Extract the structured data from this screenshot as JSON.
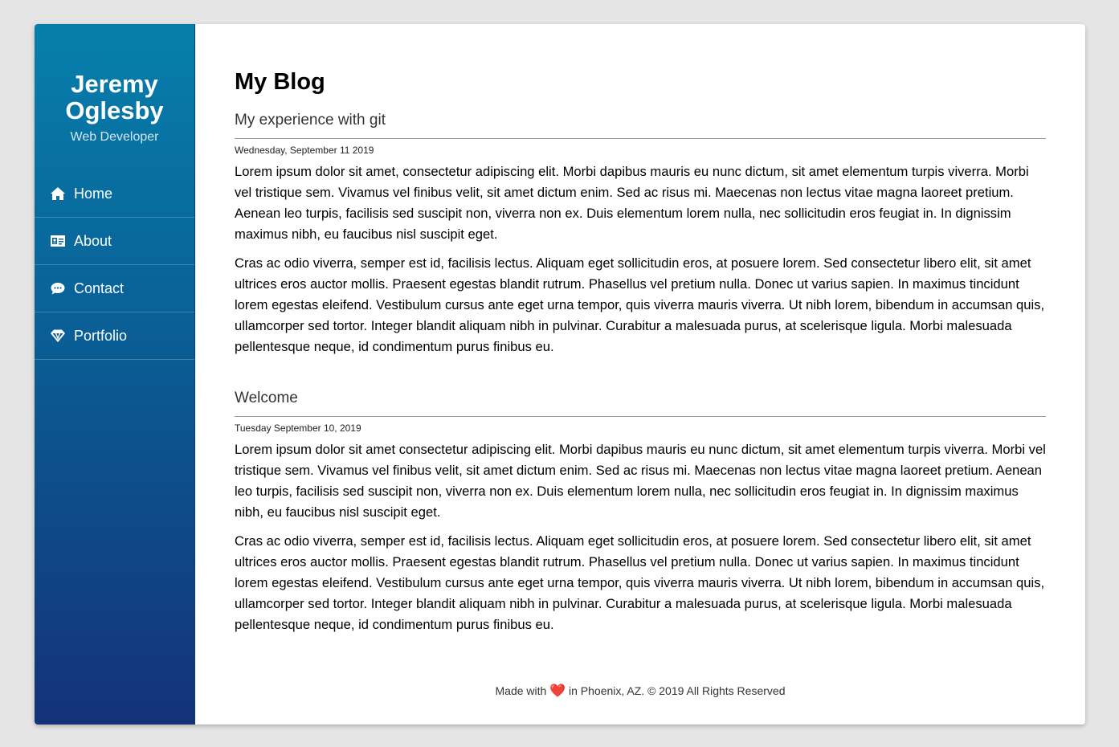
{
  "sidebar": {
    "name": "Jeremy Oglesby",
    "subtitle": "Web Developer",
    "items": [
      {
        "label": "Home",
        "icon": "home-icon"
      },
      {
        "label": "About",
        "icon": "id-card-icon"
      },
      {
        "label": "Contact",
        "icon": "chat-icon"
      },
      {
        "label": "Portfolio",
        "icon": "diamond-icon"
      }
    ]
  },
  "main": {
    "title": "My Blog",
    "posts": [
      {
        "title": "My experience with git",
        "date": "Wednesday, September 11 2019",
        "paragraphs": [
          "Lorem ipsum dolor sit amet, consectetur adipiscing elit. Morbi dapibus mauris eu nunc dictum, sit amet elementum turpis viverra. Morbi vel tristique sem. Vivamus vel finibus velit, sit amet dictum enim. Sed ac risus mi. Maecenas non lectus vitae magna laoreet pretium. Aenean leo turpis, facilisis sed suscipit non, viverra non ex. Duis elementum lorem nulla, nec sollicitudin eros feugiat in. In dignissim maximus nibh, eu faucibus nisl suscipit eget.",
          "Cras ac odio viverra, semper est id, facilisis lectus. Aliquam eget sollicitudin eros, at posuere lorem. Sed consectetur libero elit, sit amet ultrices eros auctor mollis. Praesent egestas blandit rutrum. Phasellus vel pretium nulla. Donec ut varius sapien. In maximus tincidunt lorem egestas eleifend. Vestibulum cursus ante eget urna tempor, quis viverra mauris viverra. Ut nibh lorem, bibendum in accumsan quis, ullamcorper sed tortor. Integer blandit aliquam nibh in pulvinar. Curabitur a malesuada purus, at scelerisque ligula. Morbi malesuada pellentesque neque, id condimentum purus finibus eu."
        ]
      },
      {
        "title": "Welcome",
        "date": "Tuesday September 10, 2019",
        "paragraphs": [
          "Lorem ipsum dolor sit amet consectetur adipiscing elit. Morbi dapibus mauris eu nunc dictum, sit amet elementum turpis viverra. Morbi vel tristique sem. Vivamus vel finibus velit, sit amet dictum enim. Sed ac risus mi. Maecenas non lectus vitae magna laoreet pretium. Aenean leo turpis, facilisis sed suscipit non, viverra non ex. Duis elementum lorem nulla, nec sollicitudin eros feugiat in. In dignissim maximus nibh, eu faucibus nisl suscipit eget.",
          "Cras ac odio viverra, semper est id, facilisis lectus. Aliquam eget sollicitudin eros, at posuere lorem. Sed consectetur libero elit, sit amet ultrices eros auctor mollis. Praesent egestas blandit rutrum. Phasellus vel pretium nulla. Donec ut varius sapien. In maximus tincidunt lorem egestas eleifend. Vestibulum cursus ante eget urna tempor, quis viverra mauris viverra. Ut nibh lorem, bibendum in accumsan quis, ullamcorper sed tortor. Integer blandit aliquam nibh in pulvinar. Curabitur a malesuada purus, at scelerisque ligula. Morbi malesuada pellentesque neque, id condimentum purus finibus eu."
        ]
      }
    ]
  },
  "footer": {
    "before": "Made with",
    "heart": "❤️",
    "after": "in Phoenix, AZ. © 2019 All Rights Reserved"
  },
  "colors": {
    "sidebar_top": "#067fac",
    "sidebar_bottom": "#143278",
    "heart": "#e0242d"
  }
}
